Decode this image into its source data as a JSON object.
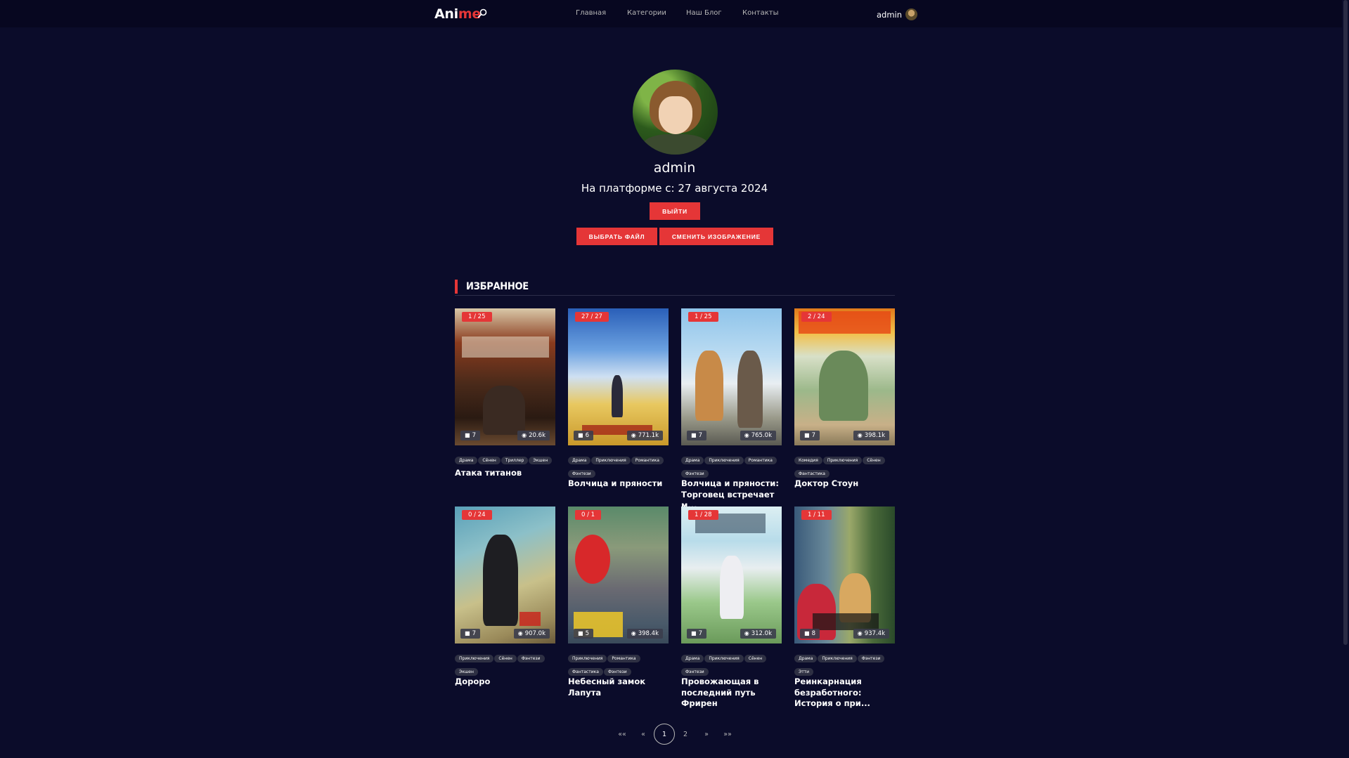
{
  "header": {
    "logo_part1": "Ani",
    "logo_part2": "me",
    "nav": [
      "Главная",
      "Категории",
      "Наш Блог",
      "Контакты"
    ],
    "username": "admin"
  },
  "profile": {
    "username": "admin",
    "joined": "На платформе с: 27 августа 2024",
    "logout_label": "ВЫЙТИ",
    "choose_file_label": "ВЫБРАТЬ ФАЙЛ",
    "change_image_label": "СМЕНИТЬ ИЗОБРАЖЕНИЕ"
  },
  "favorites": {
    "title": "ИЗБРАННОЕ",
    "cards": [
      {
        "episodes": "1 / 25",
        "comments": "7",
        "views": "20.6k",
        "tags": [
          "Драма",
          "Сёнен",
          "Триллер",
          "Экшен"
        ],
        "title": "Атака титанов"
      },
      {
        "episodes": "27 / 27",
        "comments": "6",
        "views": "771.1k",
        "tags": [
          "Драма",
          "Приключения",
          "Романтика",
          "Фэнтези"
        ],
        "title": "Волчица и пряности"
      },
      {
        "episodes": "1 / 25",
        "comments": "7",
        "views": "765.0k",
        "tags": [
          "Драма",
          "Приключения",
          "Романтика",
          "Фэнтези"
        ],
        "title": "Волчица и пряности: Торговец встречает м..."
      },
      {
        "episodes": "2 / 24",
        "comments": "7",
        "views": "398.1k",
        "tags": [
          "Комедия",
          "Приключения",
          "Сёнен",
          "Фантастика"
        ],
        "title": "Доктор Стоун"
      },
      {
        "episodes": "0 / 24",
        "comments": "7",
        "views": "907.0k",
        "tags": [
          "Приключения",
          "Сёнен",
          "Фэнтези",
          "Экшен"
        ],
        "title": "Дороро"
      },
      {
        "episodes": "0 / 1",
        "comments": "5",
        "views": "398.4k",
        "tags": [
          "Приключения",
          "Романтика",
          "Фантастика",
          "Фэнтези"
        ],
        "title": "Небесный замок Лапута"
      },
      {
        "episodes": "1 / 28",
        "comments": "7",
        "views": "312.0k",
        "tags": [
          "Драма",
          "Приключения",
          "Сёнен",
          "Фэнтези"
        ],
        "title": "Провожающая в последний путь Фрирен"
      },
      {
        "episodes": "1 / 11",
        "comments": "8",
        "views": "937.4k",
        "tags": [
          "Драма",
          "Приключения",
          "Фэнтези",
          "Этти"
        ],
        "title": "Реинкарнация безработного: История о при..."
      }
    ]
  },
  "pagination": {
    "first": "««",
    "prev": "«",
    "pages": [
      "1",
      "2"
    ],
    "next": "»",
    "last": "»»",
    "current": "1"
  },
  "colors": {
    "background": "#0b0c2a",
    "header": "#070720",
    "accent": "#e53637",
    "tag_bg": "#2e3043"
  }
}
